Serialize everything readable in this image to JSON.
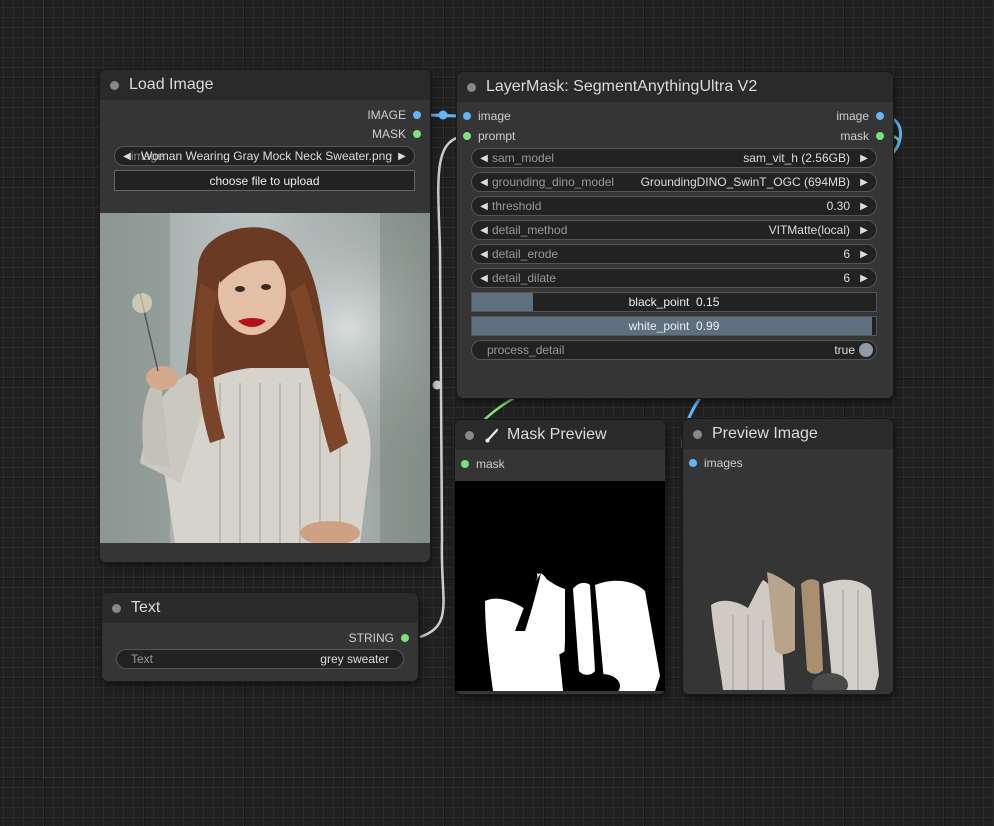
{
  "load_image": {
    "title": "Load Image",
    "outputs": [
      "IMAGE",
      "MASK"
    ],
    "image_label": "image",
    "image_file": "Woman Wearing Gray Mock Neck Sweater.png",
    "upload_label": "choose file to upload"
  },
  "text_node": {
    "title": "Text",
    "output": "STRING",
    "widget_label": "Text",
    "widget_value": "grey sweater"
  },
  "segment": {
    "title": "LayerMask: SegmentAnythingUltra V2",
    "inputs": [
      "image",
      "prompt"
    ],
    "outputs": [
      "image",
      "mask"
    ],
    "widgets": [
      {
        "label": "sam_model",
        "value": "sam_vit_h (2.56GB)"
      },
      {
        "label": "grounding_dino_model",
        "value": "GroundingDINO_SwinT_OGC (694MB)"
      },
      {
        "label": "threshold",
        "value": "0.30"
      },
      {
        "label": "detail_method",
        "value": "VITMatte(local)"
      },
      {
        "label": "detail_erode",
        "value": "6"
      },
      {
        "label": "detail_dilate",
        "value": "6"
      }
    ],
    "black_point": {
      "label": "black_point",
      "value": "0.15",
      "fraction": 0.15
    },
    "white_point": {
      "label": "white_point",
      "value": "0.99",
      "fraction": 0.99
    },
    "process_detail": {
      "label": "process_detail",
      "value": "true"
    }
  },
  "mask_preview": {
    "title": "Mask Preview",
    "input": "mask"
  },
  "preview_image": {
    "title": "Preview Image",
    "input": "images"
  },
  "colors": {
    "image_link": "#64b5f6",
    "mask_link": "#7ee07e",
    "string_link": "#cccccc",
    "slider_fill": "#5e6f80"
  }
}
